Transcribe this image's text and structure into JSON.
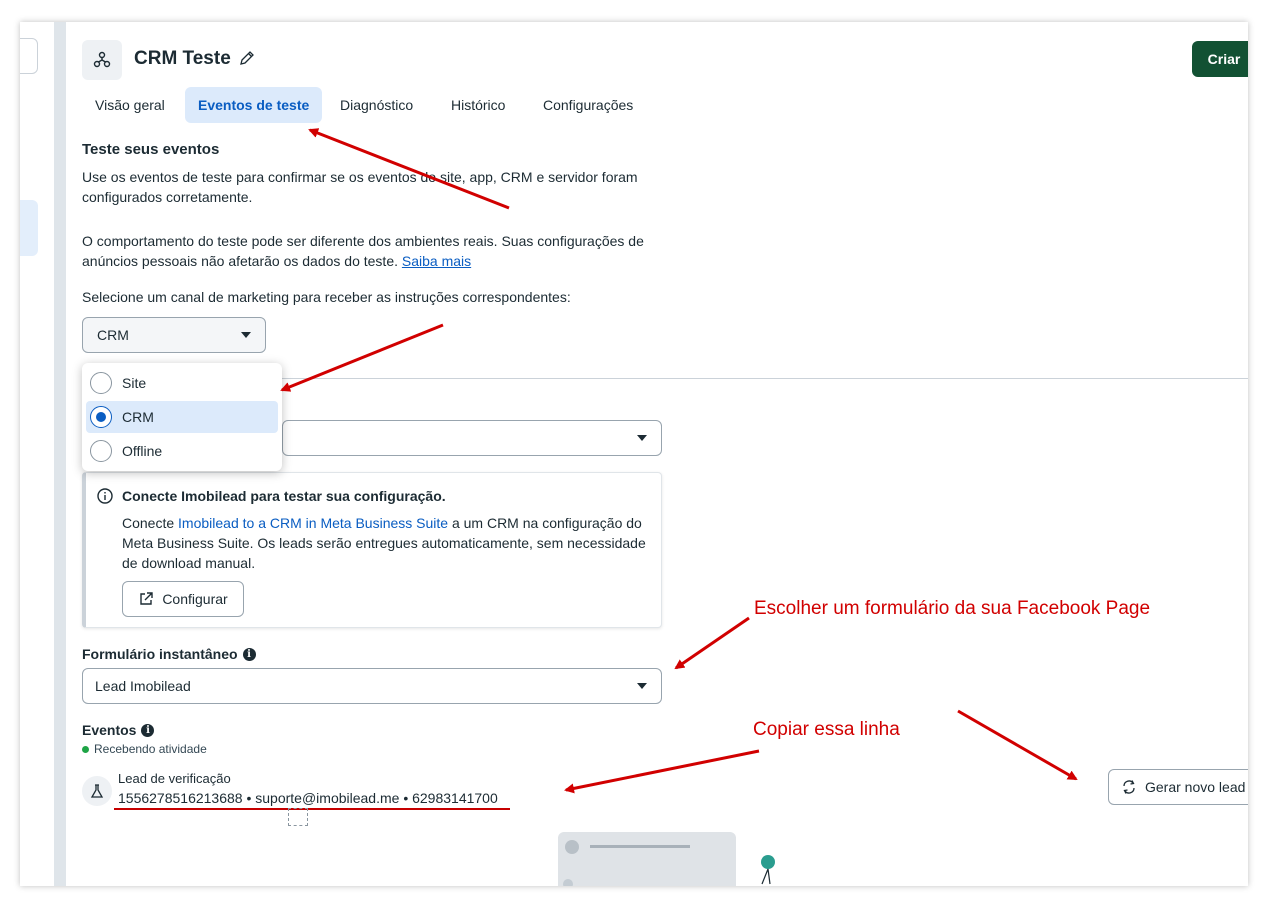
{
  "header": {
    "title": "CRM Teste",
    "create_button": "Criar"
  },
  "tabs": [
    {
      "label": "Visão geral"
    },
    {
      "label": "Eventos de teste"
    },
    {
      "label": "Diagnóstico"
    },
    {
      "label": "Histórico"
    },
    {
      "label": "Configurações"
    }
  ],
  "intro": {
    "heading": "Teste seus eventos",
    "p1": "Use os eventos de teste para confirmar se os eventos do site, app, CRM e servidor foram configurados corretamente.",
    "p2": "O comportamento do teste pode ser diferente dos ambientes reais. Suas configurações de anúncios pessoais não afetarão os dados do teste.",
    "p2_link": "Saiba mais",
    "select_prompt": "Selecione um canal de marketing para receber as instruções correspondentes:"
  },
  "channel_select": {
    "value": "CRM",
    "options": [
      "Site",
      "CRM",
      "Offline"
    ]
  },
  "info_box": {
    "title": "Conecte Imobilead para testar sua configuração.",
    "text_before": "Conecte ",
    "text_link": "Imobilead to a CRM in Meta Business Suite",
    "text_after": " a um CRM na configuração do Meta Business Suite. Os leads serão entregues automaticamente, sem necessidade de download manual.",
    "button": "Configurar"
  },
  "instant_form": {
    "label": "Formulário instantâneo",
    "value": "Lead Imobilead"
  },
  "events": {
    "label": "Eventos",
    "status": "Recebendo atividade",
    "item_name": "Lead de verificação",
    "item_line": "1556278516213688 • suporte@imobilead.me • 62983141700",
    "new_lead_button": "Gerar novo lead"
  },
  "annotations": {
    "form_note": "Escolher um formulário da sua Facebook Page",
    "copy_note": "Copiar essa linha"
  },
  "colors": {
    "accent": "#0a5dc2",
    "create_button": "#125133",
    "annotation": "#d10000",
    "status_green": "#1ea446"
  }
}
